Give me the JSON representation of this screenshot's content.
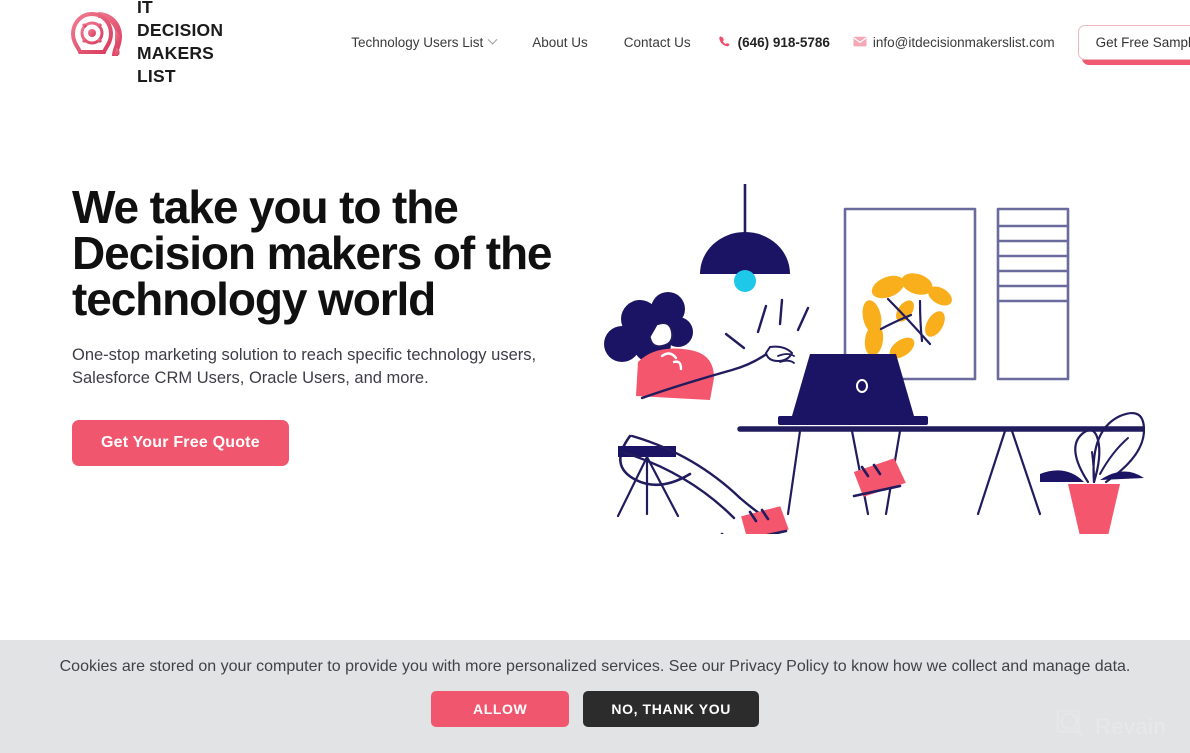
{
  "brand": {
    "logo_icon": "lightbulb-gear-head-icon",
    "name": "IT DECISION\nMAKERS LIST",
    "accent": "#f0566e",
    "navy": "#1c1b4b"
  },
  "nav": {
    "items": [
      {
        "label": "Technology Users List",
        "has_dropdown": true
      },
      {
        "label": "About Us",
        "has_dropdown": false
      },
      {
        "label": "Contact Us",
        "has_dropdown": false
      }
    ],
    "phone": {
      "icon": "phone-icon",
      "label": "(646) 918-5786"
    },
    "email": {
      "icon": "envelope-icon",
      "label": "info@itdecisionmakerslist.com"
    },
    "cta": {
      "label": "Get Free Samples"
    }
  },
  "hero": {
    "headline": "We take you to the\nDecision makers of the\ntechnology world",
    "subhead": "One-stop marketing solution to reach specific technology users,\nSalesforce CRM Users, Oracle Users, and more.",
    "cta": {
      "label": "Get Your Free Quote"
    },
    "illustration": "person-working-at-desk-illustration"
  },
  "cookie_banner": {
    "text": "Cookies are stored on your computer to provide you with more personalized services. See our Privacy Policy to know how we collect and manage data.",
    "allow_label": "ALLOW",
    "deny_label": "NO, THANK YOU"
  },
  "watermark": {
    "label": "Revain",
    "icon": "revain-logo-icon"
  }
}
